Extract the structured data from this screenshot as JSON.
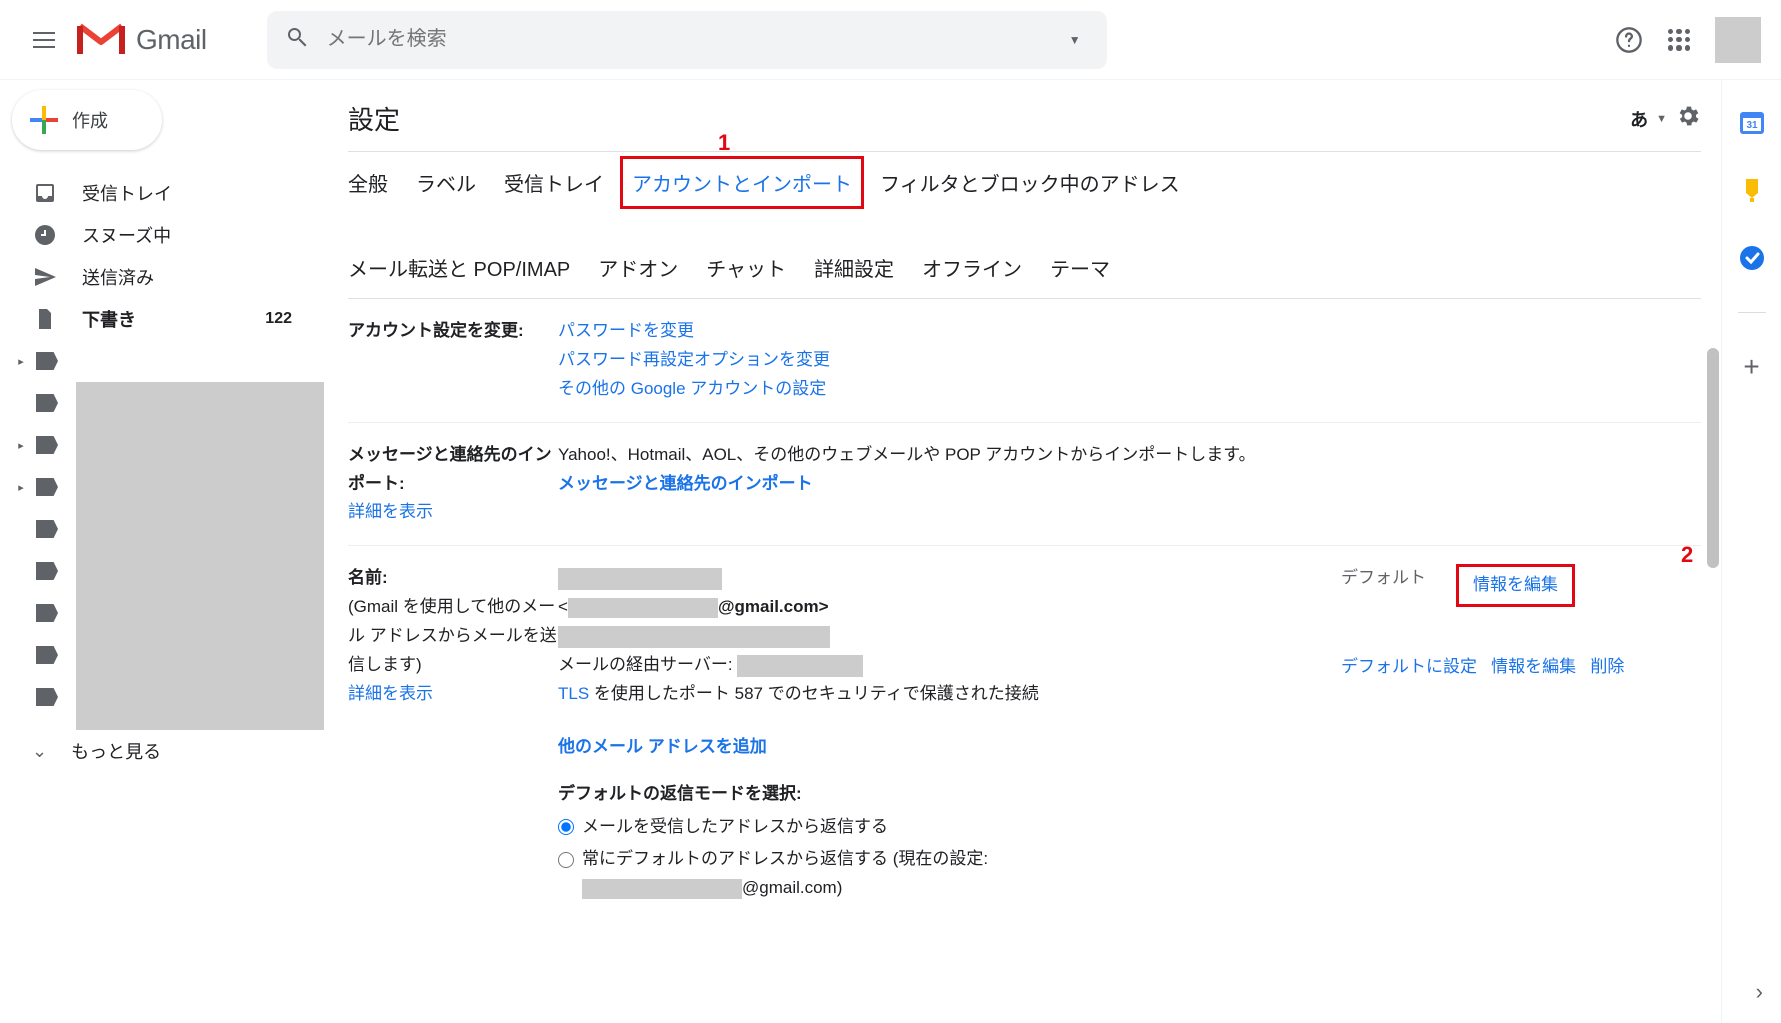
{
  "header": {
    "product": "Gmail",
    "search_placeholder": "メールを検索",
    "lang_label": "あ"
  },
  "sidebar": {
    "compose": "作成",
    "items": [
      {
        "label": "受信トレイ",
        "icon": "inbox"
      },
      {
        "label": "スヌーズ中",
        "icon": "clock"
      },
      {
        "label": "送信済み",
        "icon": "send"
      },
      {
        "label": "下書き",
        "icon": "draft",
        "count": "122",
        "bold": true
      }
    ],
    "more": "もっと見る"
  },
  "settings": {
    "title": "設定",
    "tabs_row1": [
      "全般",
      "ラベル",
      "受信トレイ",
      "アカウントとインポート",
      "フィルタとブロック中のアドレス"
    ],
    "tabs_row2": [
      "メール転送と POP/IMAP",
      "アドオン",
      "チャット",
      "詳細設定",
      "オフライン",
      "テーマ"
    ],
    "active_tab_index": 3,
    "annotations": {
      "num1": "1",
      "num2": "2"
    },
    "account_change": {
      "label": "アカウント設定を変更:",
      "links": [
        "パスワードを変更",
        "パスワード再設定オプションを変更",
        "その他の Google アカウントの設定"
      ]
    },
    "import_msgs": {
      "label": "メッセージと連絡先のインポート:",
      "detail_link": "詳細を表示",
      "text": "Yahoo!、Hotmail、AOL、その他のウェブメールや POP アカウントからインポートします。",
      "action": "メッセージと連絡先のインポート"
    },
    "name": {
      "label": "名前:",
      "sub": "(Gmail を使用して他のメール アドレスからメールを送信します)",
      "detail_link": "詳細を表示",
      "email_suffix": "@gmail.com>",
      "email_prefix": "<",
      "relay_label": "メールの経由サーバー:",
      "tls_prefix": "TLS",
      "tls_rest": " を使用したポート 587 でのセキュリティで保護された接続",
      "default_label": "デフォルト",
      "edit1": "情報を編集",
      "set_default": "デフォルトに設定",
      "edit2": "情報を編集",
      "delete": "削除",
      "add_another": "他のメール アドレスを追加",
      "reply_mode_label": "デフォルトの返信モードを選択:",
      "reply_opt1": "メールを受信したアドレスから返信する",
      "reply_opt2": "常にデフォルトのアドレスから返信する (現在の設定:",
      "reply_opt2_suffix": "@gmail.com)"
    }
  },
  "mini_sidebar": {
    "calendar_day": "31"
  }
}
